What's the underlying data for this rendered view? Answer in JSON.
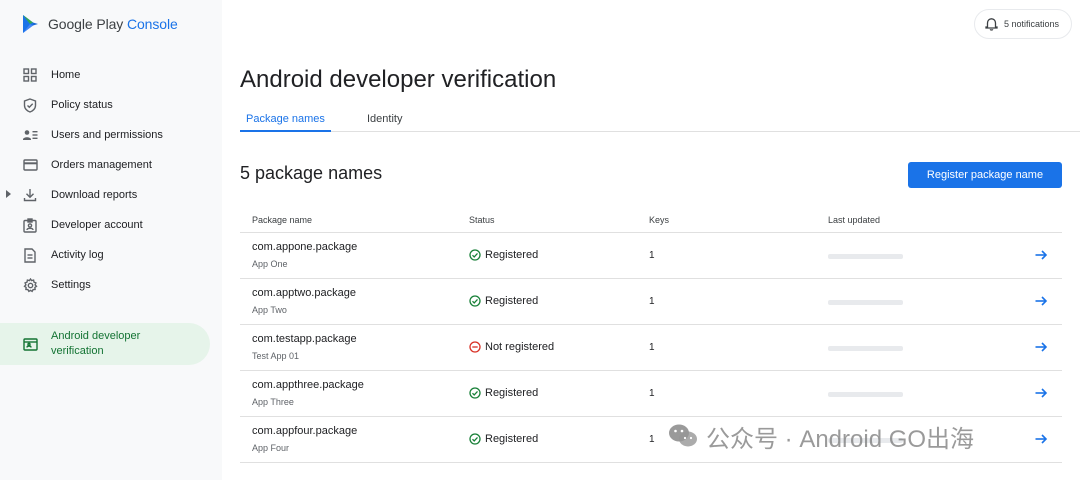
{
  "app": {
    "logo_text": "Google Play",
    "logo_suffix": "Console"
  },
  "header": {
    "notifications_label": "5 notifications"
  },
  "sidebar": {
    "items": [
      {
        "label": "Home",
        "icon": "grid-icon"
      },
      {
        "label": "Policy status",
        "icon": "shield-icon"
      },
      {
        "label": "Users and permissions",
        "icon": "users-icon"
      },
      {
        "label": "Orders management",
        "icon": "card-icon"
      },
      {
        "label": "Download reports",
        "icon": "download-icon"
      },
      {
        "label": "Developer account",
        "icon": "badge-icon"
      },
      {
        "label": "Activity log",
        "icon": "document-icon"
      },
      {
        "label": "Settings",
        "icon": "gear-icon"
      }
    ],
    "active": {
      "label": "Android developer verification",
      "icon": "verification-icon"
    }
  },
  "main": {
    "title": "Android developer verification",
    "tabs": [
      {
        "label": "Package names",
        "selected": true
      },
      {
        "label": "Identity",
        "selected": false
      }
    ],
    "section_title": "5 package names",
    "register_button": "Register package name",
    "table": {
      "headers": [
        "Package name",
        "Status",
        "Keys",
        "Last updated"
      ],
      "rows": [
        {
          "package": "com.appone.package",
          "app": "App One",
          "status": "Registered",
          "keys": "1"
        },
        {
          "package": "com.apptwo.package",
          "app": "App Two",
          "status": "Registered",
          "keys": "1"
        },
        {
          "package": "com.testapp.package",
          "app": "Test App 01",
          "status": "Not registered",
          "keys": "1"
        },
        {
          "package": "com.appthree.package",
          "app": "App Three",
          "status": "Registered",
          "keys": "1"
        },
        {
          "package": "com.appfour.package",
          "app": "App Four",
          "status": "Registered",
          "keys": "1"
        }
      ]
    }
  },
  "watermark": {
    "text": "公众号 · Android GO出海"
  },
  "colors": {
    "accent": "#1a73e8",
    "active_bg": "#e6f4ea",
    "active_text": "#137333",
    "registered": "#188038",
    "not_registered": "#d93025"
  }
}
